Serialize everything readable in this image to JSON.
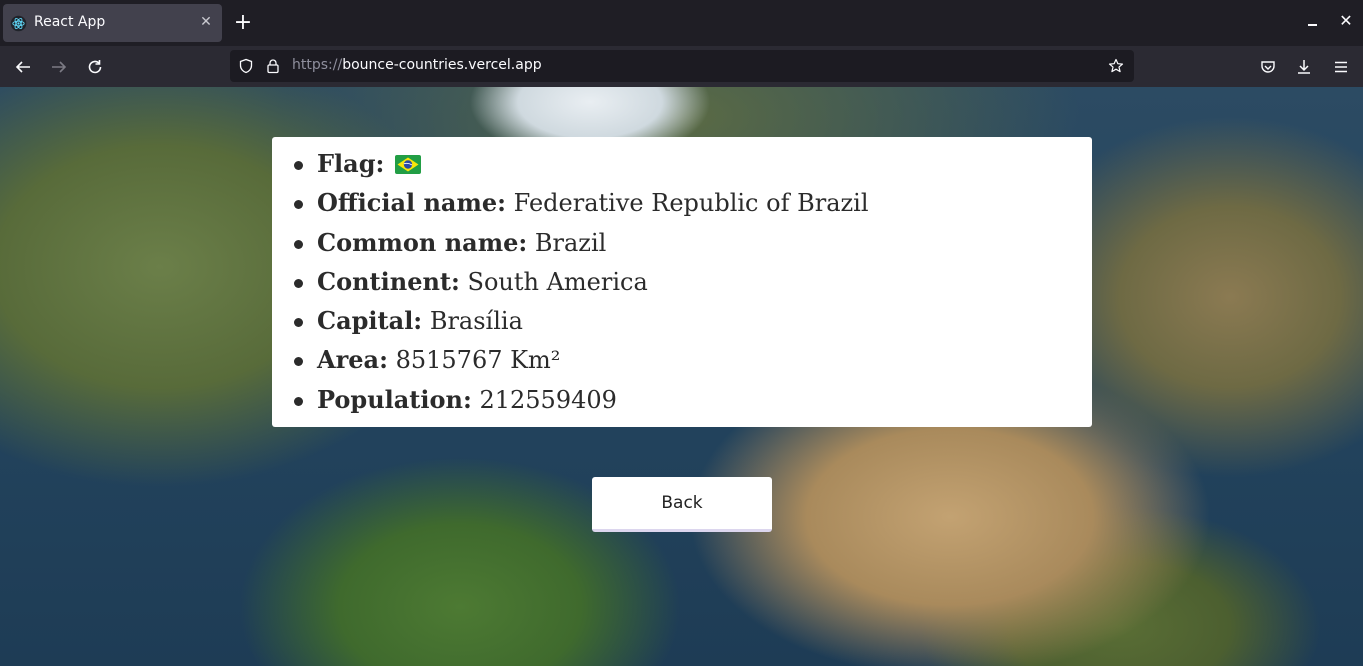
{
  "browser": {
    "tab_title": "React App",
    "url_scheme": "https://",
    "url_host": "bounce-countries.vercel.app",
    "icons": [
      "react-favicon",
      "close-icon",
      "plus-icon",
      "minimize-icon",
      "back-arrow-icon",
      "forward-arrow-icon",
      "reload-icon",
      "shield-icon",
      "lock-icon",
      "star-icon",
      "pocket-icon",
      "download-icon",
      "menu-icon"
    ]
  },
  "country": {
    "flag_label": "Flag:",
    "official_name_label": "Official name:",
    "official_name": "Federative Republic of Brazil",
    "common_name_label": "Common name:",
    "common_name": "Brazil",
    "continent_label": "Continent:",
    "continent": "South America",
    "capital_label": "Capital:",
    "capital": "Brasília",
    "area_label": "Area:",
    "area": "8515767 Km²",
    "population_label": "Population:",
    "population": "212559409"
  },
  "actions": {
    "back_label": "Back"
  },
  "colors": {
    "tab_active": "#42414d",
    "toolbar": "#2b2a33",
    "urlbar": "#1c1b22",
    "card": "#ffffff"
  }
}
